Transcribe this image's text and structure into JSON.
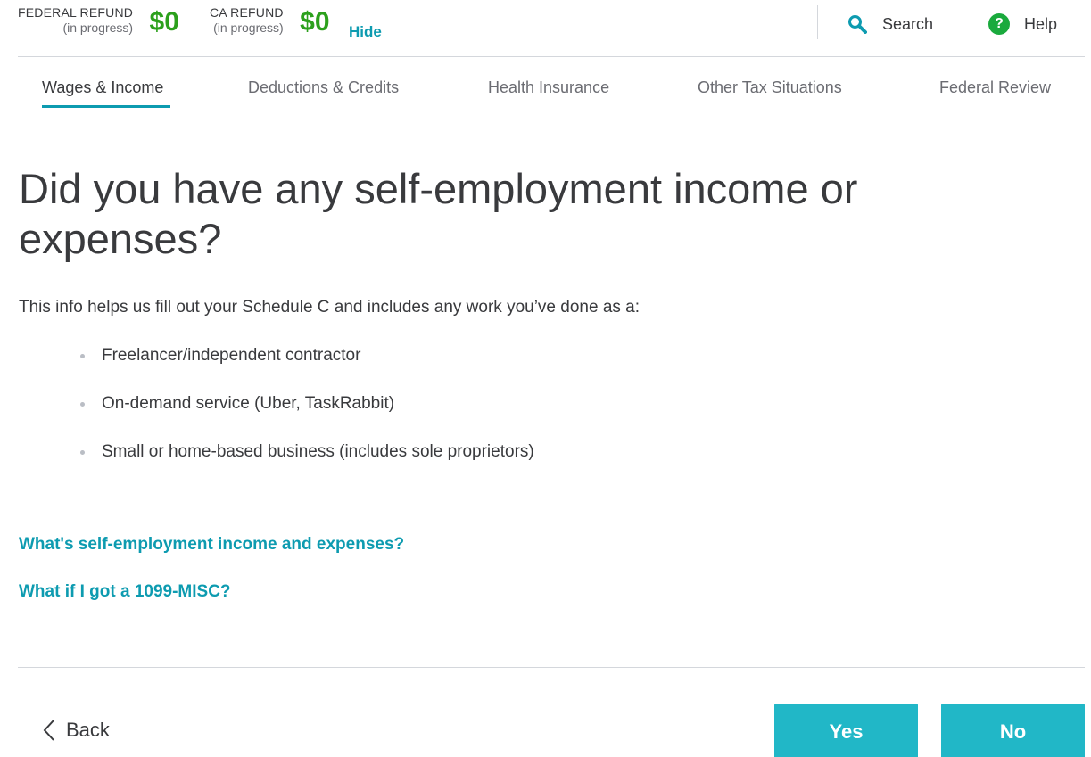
{
  "header": {
    "federal_refund": {
      "label": "FEDERAL REFUND",
      "status": "(in progress)",
      "amount": "$0"
    },
    "ca_refund": {
      "label": "CA REFUND",
      "status": "(in progress)",
      "amount": "$0"
    },
    "hide_label": "Hide",
    "search_label": "Search",
    "help_label": "Help",
    "help_icon_glyph": "?"
  },
  "tabs": [
    {
      "label": "Wages & Income",
      "active": true
    },
    {
      "label": "Deductions & Credits",
      "active": false
    },
    {
      "label": "Health Insurance",
      "active": false
    },
    {
      "label": "Other Tax Situations",
      "active": false
    },
    {
      "label": "Federal Review",
      "active": false
    }
  ],
  "main": {
    "heading": "Did you have any self-employment income or expenses?",
    "intro": "This info helps us fill out your Schedule C and includes any work you’ve done as a:",
    "bullets": [
      "Freelancer/independent contractor",
      "On-demand service (Uber, TaskRabbit)",
      "Small or home-based business (includes sole proprietors)"
    ],
    "links": [
      "What's self-employment income and expenses?",
      "What if I got a 1099-MISC?"
    ]
  },
  "footer": {
    "back_label": "Back",
    "yes_label": "Yes",
    "no_label": "No"
  },
  "colors": {
    "refund_green": "#2ca01c",
    "link_teal": "#0d9bb0",
    "button_teal": "#21b7c7",
    "help_green": "#1aaa3d"
  }
}
